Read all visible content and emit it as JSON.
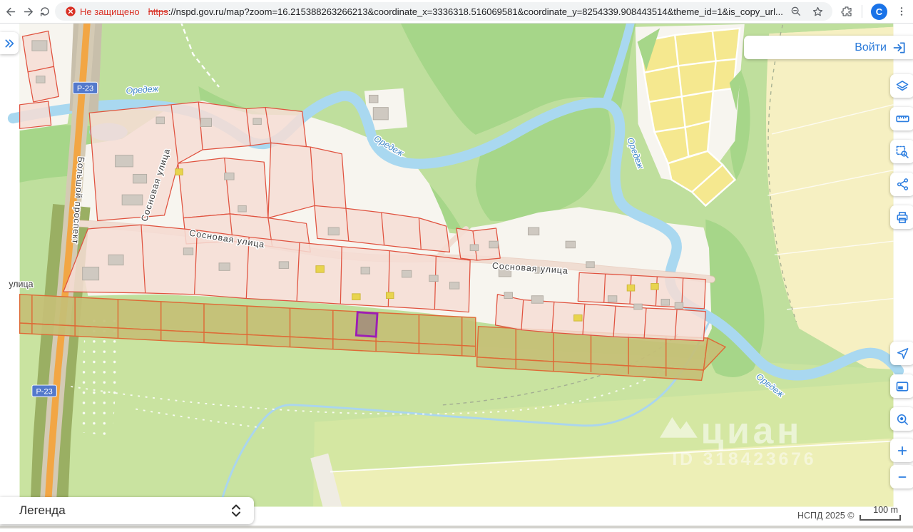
{
  "browser": {
    "security_label": "Не защищено",
    "url_protocol": "https",
    "url_rest": "://nspd.gov.ru/map?zoom=16.215388263266213&coordinate_x=3336318.516069581&coordinate_y=8254339.908443514&theme_id=1&is_copy_url...",
    "profile_initial": "C"
  },
  "ui": {
    "login_label": "Войти",
    "legend_label": "Легенда",
    "attribution": "НСПД 2025 ©",
    "scale_label": "100 m",
    "watermark_brand": "циан",
    "watermark_id": "ID 318423676"
  },
  "labels": {
    "river": "Оредеж",
    "road_badge": "Р-23",
    "street_sosnovaya": "Сосновая улица",
    "street_bolshoy": "Большой проспект",
    "street_ulitsa": "улица"
  },
  "colors": {
    "accent_blue": "#2b7de0",
    "parcel_outline_red": "#e0523f",
    "selected_parcel_purple": "#9c1db6",
    "zone_band_olive": "#c6bf76",
    "water_blue": "#a9d8f0"
  }
}
